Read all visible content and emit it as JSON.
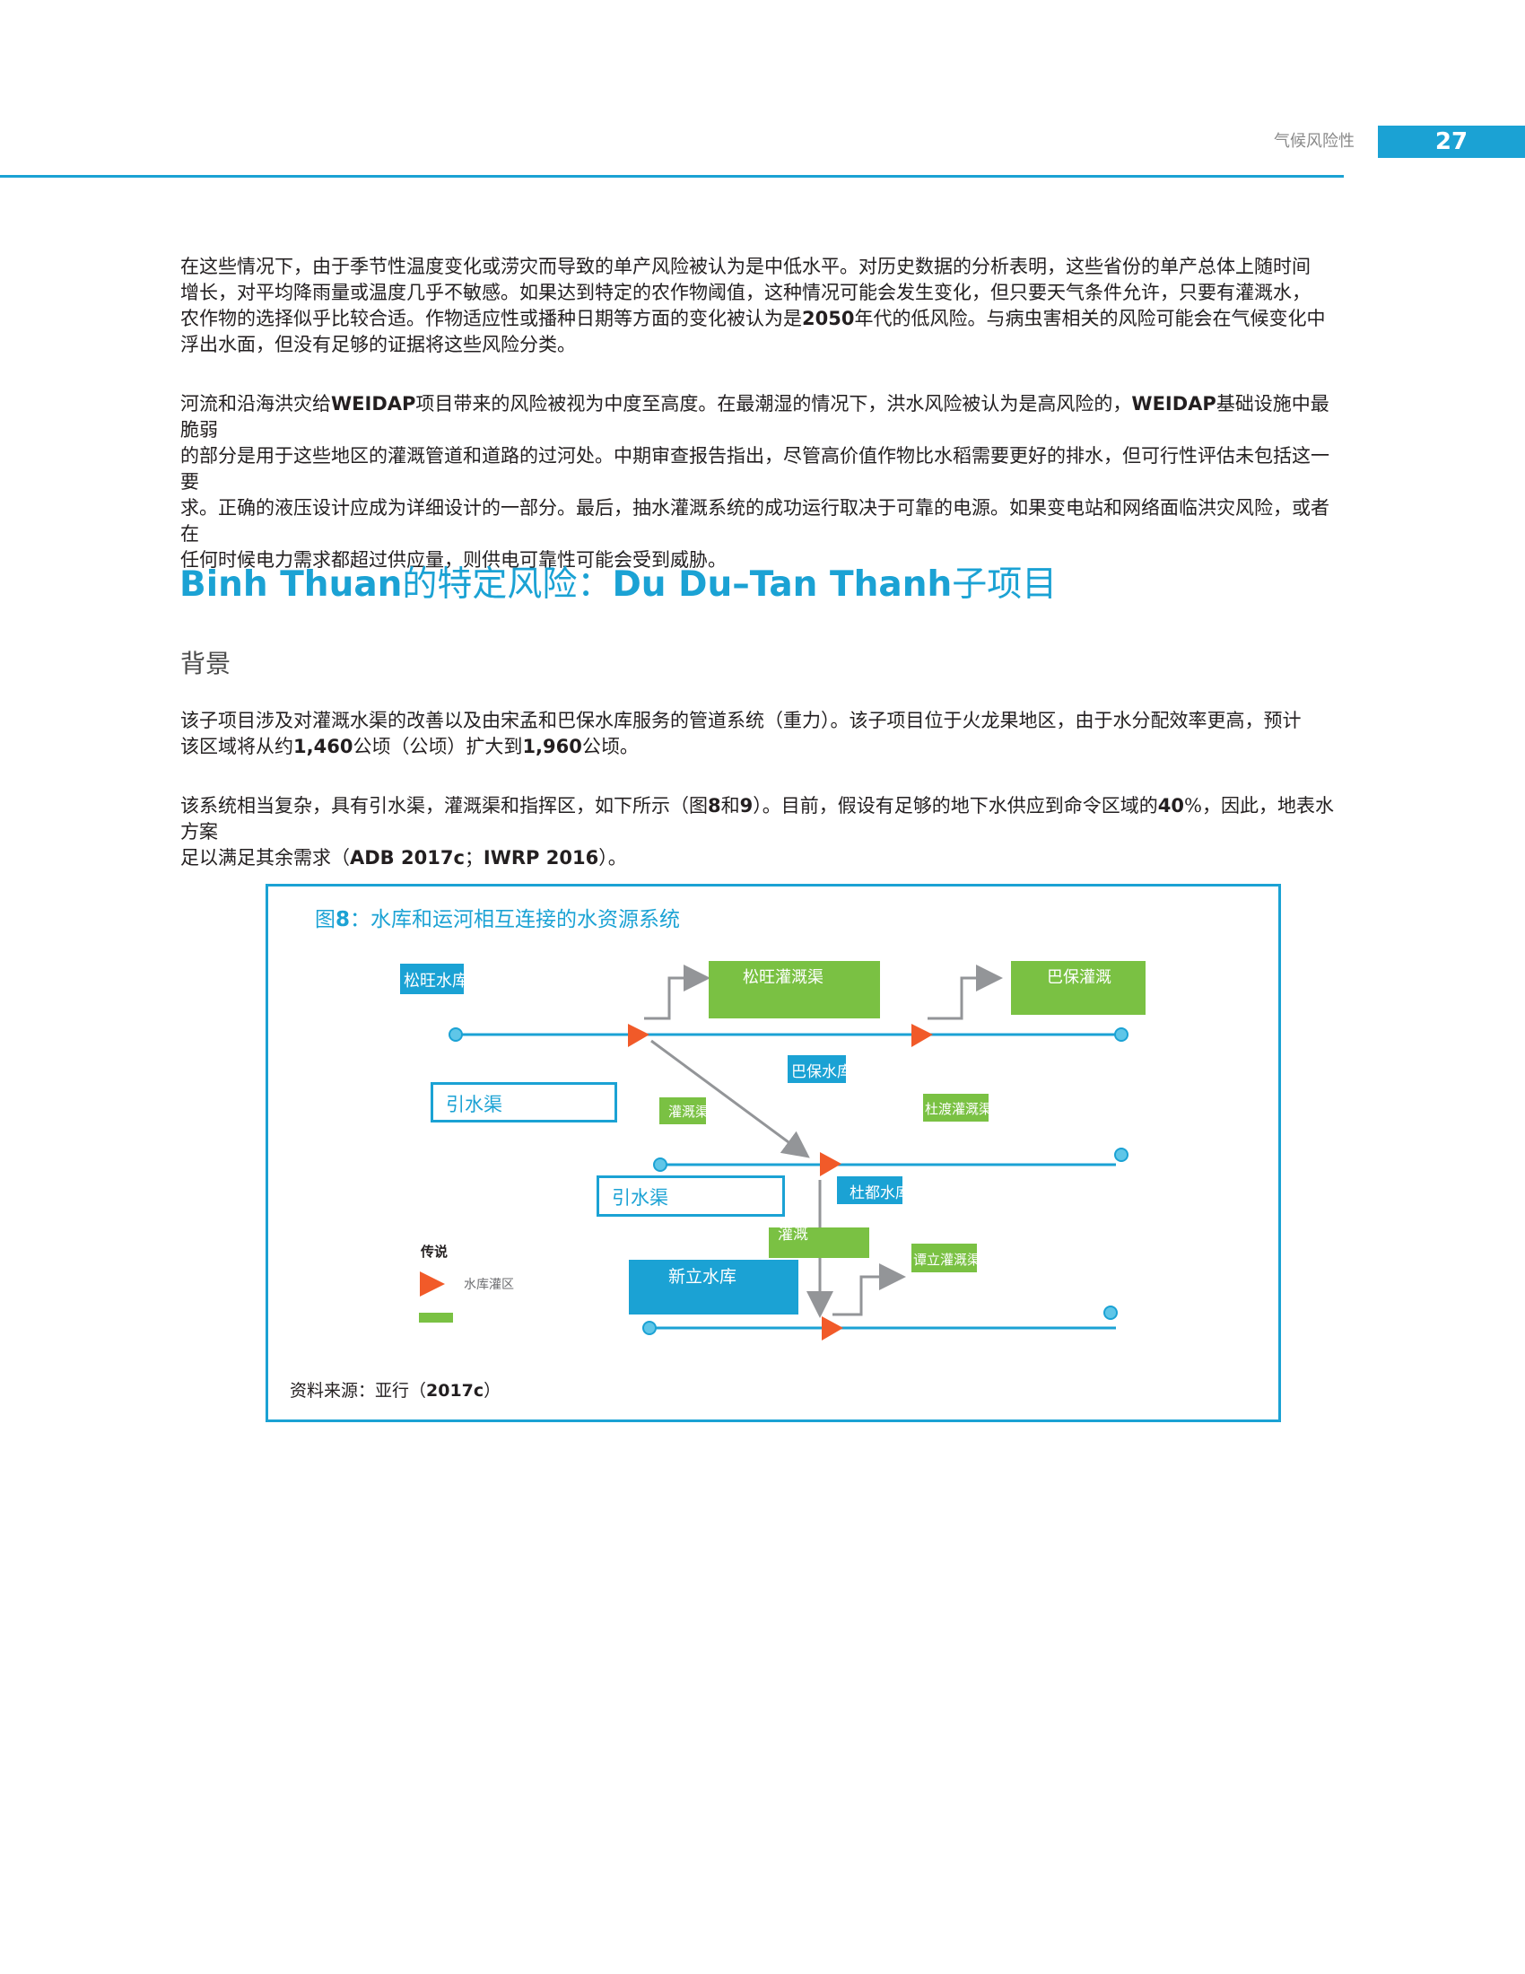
{
  "header": {
    "section_title": "气候风险性",
    "page_number": "27"
  },
  "paragraphs": [
    {
      "lines": [
        "在这些情况下，由于季节性温度变化或涝灾而导致的单产风险被认为是中低水平。对历史数据的分析表明，这些省份的单产总体上随时间",
        "增长，对平均降雨量或温度几乎不敏感。如果达到特定的农作物阈值，这种情况可能会发生变化，但只要天气条件允许，只要有灌溉水，",
        "农作物的选择似乎比较合适。作物适应性或播种日期等方面的变化被认为是",
        "2050",
        "年代的低风险。与病虫害相关的风险可能会在气候变化中",
        "浮出水面，但没有足够的证据将这些风险分类。"
      ]
    },
    {
      "lines": [
        "河流和沿海洪灾给",
        "WEIDAP",
        "项目带来的风险被视为中度至高度。在最潮湿的情况下，洪水风险被认为是高风险的，",
        "WEIDAP",
        "基础设施中最脆弱",
        "的部分是用于这些地区的灌溉管道和道路的过河处。中期审查报告指出，尽管高价值作物比水稻需要更好的排水，但可行性评估未包括这一要",
        "求。正确的液压设计应成为详细设计的一部分。最后，抽水灌溉系统的成功运行取决于可靠的电源。如果变电站和网络面临洪灾风险，或者在",
        "任何时候电力需求都超过供应量，则供电可靠性可能会受到威胁。"
      ]
    }
  ],
  "section": {
    "title_part1": "Binh Thuan",
    "title_part2": "的特定风险：",
    "title_part3": "Du Du–Tan Thanh",
    "title_part4": "子项目",
    "subheading": "背景"
  },
  "background": {
    "p1": [
      "该子项目涉及对灌溉水渠的改善以及由宋孟和巴保水库服务的管道系统（重力）。该子项目位于火龙果地区，由于水分配效率更高，预计",
      "该区域将从约",
      "1,460",
      "公顷（公顷）扩大到",
      "1,960",
      "公顷。"
    ],
    "p2": [
      "该系统相当复杂，具有引水渠，灌溉渠和指挥区，如下所示（图",
      "8",
      "和",
      "9",
      "）。目前，假设有足够的地下水供应到命令区域的",
      "40",
      "%，因此，地表水方案",
      "足以满足其余需求（",
      "ADB 2017c",
      "；",
      "IWRP 2016",
      "）。"
    ]
  },
  "figure": {
    "label": "图",
    "number": "8",
    "title": "：水库和运河相互连接的水资源系统",
    "boxes": {
      "song_vang_reservoir": "松旺水库",
      "song_vang_irrigation": "松旺灌溉渠",
      "ba_bao_irrigation": "巴保灌溉",
      "ba_bao_reservoir": "巴保水库",
      "diversion_canal_1": "引水渠",
      "irrigation_canal": "灌溉渠",
      "du_du_irrigation": "杜渡灌溉渠",
      "diversion_canal_2": "引水渠",
      "du_du_reservoir": "杜都水库",
      "irrigation_small": "灌溉",
      "tan_lap_irrigation": "谭立灌溉渠",
      "tan_lap_reservoir": "新立水库"
    },
    "legend": {
      "title": "传说",
      "reservoir_command_area": "水库灌区"
    },
    "colors": {
      "accent": "#1ba2d4",
      "green": "#7ac143",
      "triangle": "#f15a29",
      "arrow": "#939598"
    },
    "source": {
      "prefix": "资料来源：亚行（",
      "ref": "2017c",
      "suffix": "）"
    }
  }
}
